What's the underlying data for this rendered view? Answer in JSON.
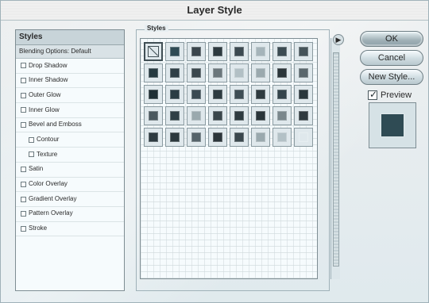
{
  "window": {
    "title": "Layer Style"
  },
  "left_panel": {
    "header": "Styles",
    "blending_options": "Blending Options: Default",
    "effects": [
      {
        "label": "Drop Shadow",
        "checked": false,
        "indent": false
      },
      {
        "label": "Inner Shadow",
        "checked": false,
        "indent": false
      },
      {
        "label": "Outer Glow",
        "checked": false,
        "indent": false
      },
      {
        "label": "Inner Glow",
        "checked": false,
        "indent": false
      },
      {
        "label": "Bevel and Emboss",
        "checked": false,
        "indent": false
      },
      {
        "label": "Contour",
        "checked": false,
        "indent": true
      },
      {
        "label": "Texture",
        "checked": false,
        "indent": true
      },
      {
        "label": "Satin",
        "checked": false,
        "indent": false
      },
      {
        "label": "Color Overlay",
        "checked": false,
        "indent": false
      },
      {
        "label": "Gradient Overlay",
        "checked": false,
        "indent": false
      },
      {
        "label": "Pattern Overlay",
        "checked": false,
        "indent": false
      },
      {
        "label": "Stroke",
        "checked": false,
        "indent": false
      }
    ]
  },
  "styles_panel": {
    "legend": "Styles",
    "swatches": [
      {
        "name": "style-none-swatch",
        "chip": "transparent",
        "selected": true,
        "type": "none"
      },
      {
        "name": "style-swatch-1",
        "chip": "#2f4b54"
      },
      {
        "name": "style-swatch-2",
        "chip": "#3a464d"
      },
      {
        "name": "style-swatch-3",
        "chip": "#2d3a40"
      },
      {
        "name": "style-swatch-4",
        "chip": "#3c4a51"
      },
      {
        "name": "style-swatch-5",
        "chip": "#a5b4ba"
      },
      {
        "name": "style-swatch-6",
        "chip": "#3b4b52"
      },
      {
        "name": "style-swatch-7",
        "chip": "#46545a"
      },
      {
        "name": "style-swatch-8",
        "chip": "#263a41"
      },
      {
        "name": "style-swatch-9",
        "chip": "#2f3f46"
      },
      {
        "name": "style-swatch-10",
        "chip": "#3b484e"
      },
      {
        "name": "style-swatch-11",
        "chip": "#6b777c"
      },
      {
        "name": "style-swatch-12",
        "chip": "#b2c0c5"
      },
      {
        "name": "style-swatch-13",
        "chip": "#9aa9ae"
      },
      {
        "name": "style-swatch-14",
        "chip": "#2b353a"
      },
      {
        "name": "style-swatch-15",
        "chip": "#5a676d"
      },
      {
        "name": "style-swatch-16",
        "chip": "#1f2f35"
      },
      {
        "name": "style-swatch-17",
        "chip": "#2a3c43"
      },
      {
        "name": "style-swatch-18",
        "chip": "#3a4a52"
      },
      {
        "name": "style-swatch-19",
        "chip": "#2d3b41"
      },
      {
        "name": "style-swatch-20",
        "chip": "#3f4e55"
      },
      {
        "name": "style-swatch-21",
        "chip": "#2f3b40"
      },
      {
        "name": "style-swatch-22",
        "chip": "#34444b"
      },
      {
        "name": "style-swatch-23",
        "chip": "#2a373c"
      },
      {
        "name": "style-swatch-24",
        "chip": "#4a585e"
      },
      {
        "name": "style-swatch-25",
        "chip": "#2f3f45"
      },
      {
        "name": "style-swatch-26",
        "chip": "#9aa9ae"
      },
      {
        "name": "style-swatch-27",
        "chip": "#3a464b"
      },
      {
        "name": "style-swatch-28",
        "chip": "#2e3b40"
      },
      {
        "name": "style-swatch-29",
        "chip": "#2a353a"
      },
      {
        "name": "style-swatch-30",
        "chip": "#7a878c"
      },
      {
        "name": "style-swatch-31",
        "chip": "#2f3a3f"
      },
      {
        "name": "style-swatch-32",
        "chip": "#2d3a40"
      },
      {
        "name": "style-swatch-33",
        "chip": "#2b383d"
      },
      {
        "name": "style-swatch-34",
        "chip": "#55636a"
      },
      {
        "name": "style-swatch-35",
        "chip": "#2b353a"
      },
      {
        "name": "style-swatch-36",
        "chip": "#3a474d"
      },
      {
        "name": "style-swatch-37",
        "chip": "#9aa9ae"
      },
      {
        "name": "style-swatch-38",
        "chip": "#b3c1c6"
      },
      {
        "name": "style-swatch-39",
        "chip": "#dfe8ec"
      }
    ]
  },
  "buttons": {
    "ok": "OK",
    "cancel": "Cancel",
    "new_style": "New Style..."
  },
  "preview": {
    "label": "Preview",
    "checked": true,
    "swatch_color": "#2f4b54"
  }
}
